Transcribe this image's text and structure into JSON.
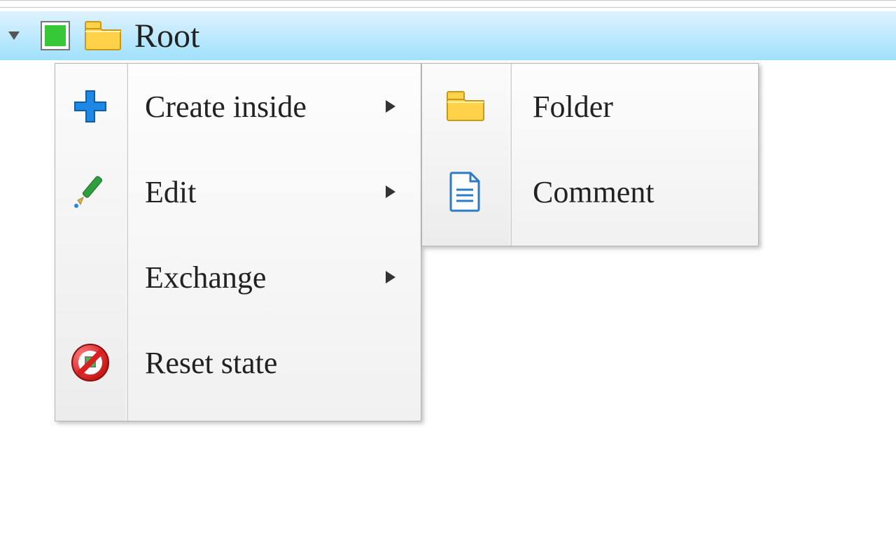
{
  "tree": {
    "root_label": "Root"
  },
  "menu": {
    "create_inside": "Create inside",
    "edit": "Edit",
    "exchange": "Exchange",
    "reset_state": "Reset state"
  },
  "submenu": {
    "folder": "Folder",
    "comment": "Comment"
  }
}
